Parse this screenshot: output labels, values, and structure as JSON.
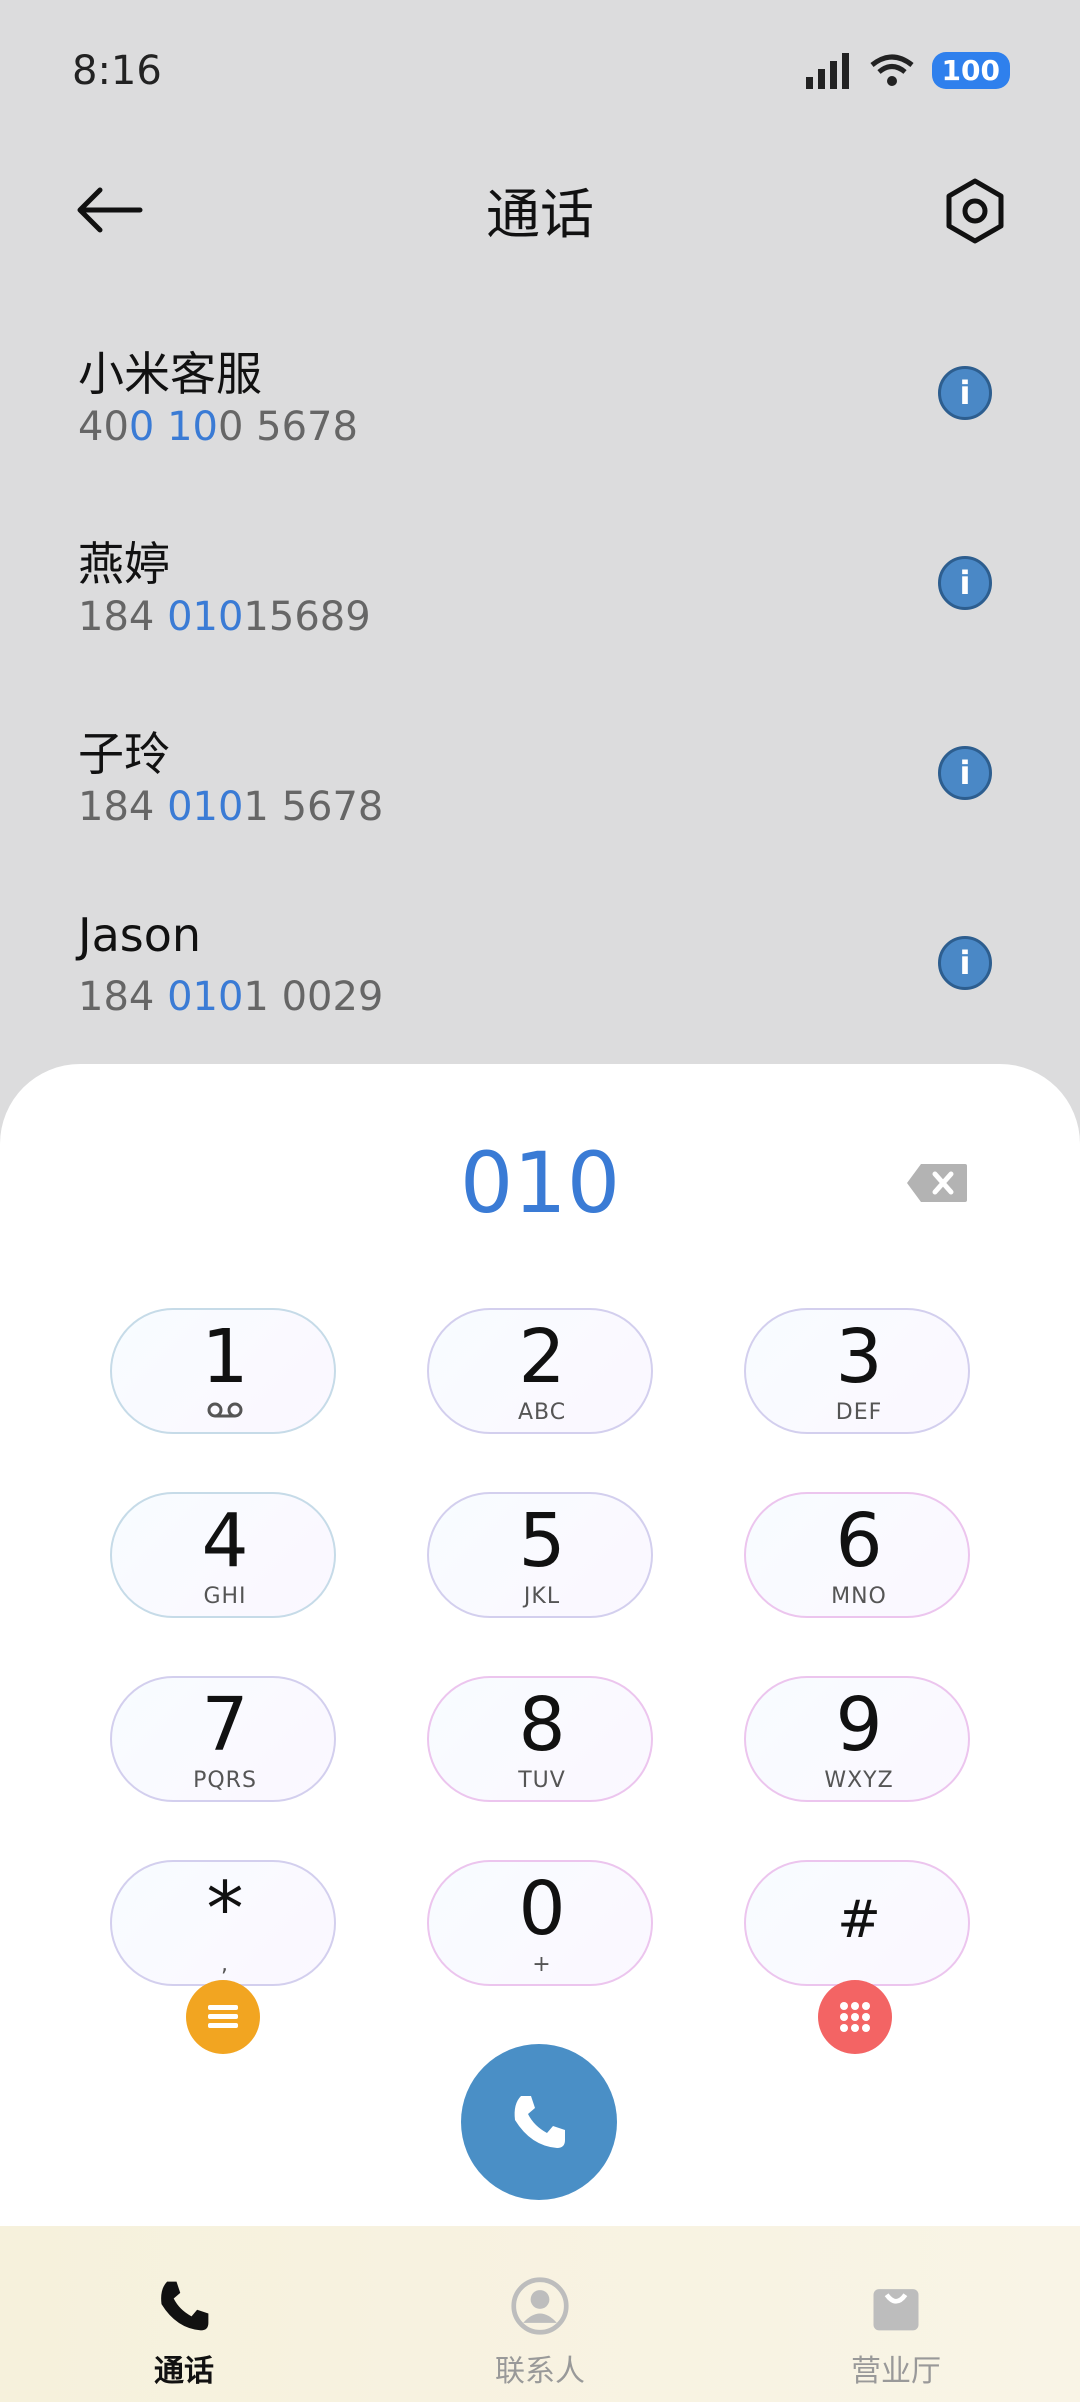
{
  "status": {
    "time": "8:16",
    "battery": "100"
  },
  "header": {
    "title": "通话"
  },
  "contacts": [
    {
      "name": "小米客服",
      "number_parts": [
        "40",
        "0 10",
        "0 5678"
      ]
    },
    {
      "name": "燕婷",
      "number_parts": [
        "184 ",
        "010",
        "15689"
      ]
    },
    {
      "name": "子玲",
      "number_parts": [
        "184 ",
        "010",
        "1 5678"
      ]
    },
    {
      "name": "Jason",
      "number_parts": [
        "184 ",
        "010",
        "1 0029"
      ]
    }
  ],
  "dialer": {
    "input": "010",
    "keys": [
      {
        "digit": "1",
        "letters": "ꝏ"
      },
      {
        "digit": "2",
        "letters": "ABC"
      },
      {
        "digit": "3",
        "letters": "DEF"
      },
      {
        "digit": "4",
        "letters": "GHI"
      },
      {
        "digit": "5",
        "letters": "JKL"
      },
      {
        "digit": "6",
        "letters": "MNO"
      },
      {
        "digit": "7",
        "letters": "PQRS"
      },
      {
        "digit": "8",
        "letters": "TUV"
      },
      {
        "digit": "9",
        "letters": "WXYZ"
      },
      {
        "digit": "*",
        "letters": ","
      },
      {
        "digit": "0",
        "letters": "+"
      },
      {
        "digit": "#",
        "letters": ""
      }
    ]
  },
  "bottom_nav": {
    "items": [
      {
        "label": "通话",
        "active": true
      },
      {
        "label": "联系人",
        "active": false
      },
      {
        "label": "营业厅",
        "active": false
      }
    ]
  },
  "colors": {
    "accent": "#3a7bd5",
    "call_button": "#4a8fc6",
    "menu_button": "#f2a521",
    "grid_button": "#f36464"
  }
}
